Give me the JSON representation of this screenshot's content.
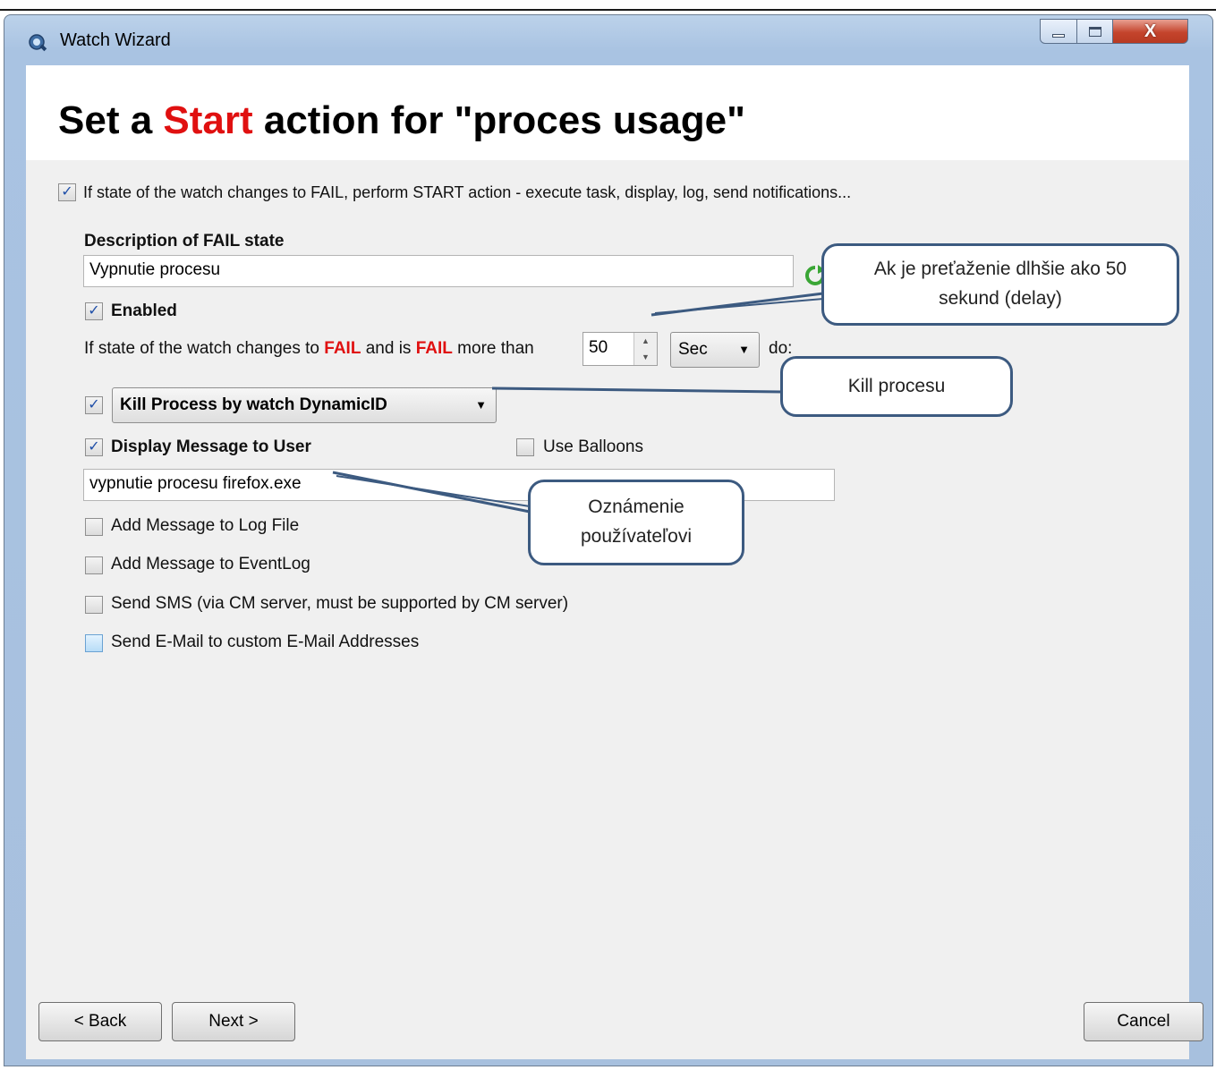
{
  "window": {
    "title": "Watch Wizard",
    "minimize_label": "minimize",
    "maximize_label": "maximize",
    "close_glyph": "X"
  },
  "header": {
    "title_prefix": "Set a ",
    "title_highlight": "Start",
    "title_suffix": " action for \"proces usage\""
  },
  "main": {
    "perform_start_label": "If state of the watch changes to FAIL, perform START action - execute task, display, log, send notifications...",
    "perform_start_checked": true,
    "description_heading": "Description of FAIL state",
    "description_value": "Vypnutie procesu",
    "enabled_label": "Enabled",
    "enabled_checked": true,
    "delay_text_1": "If state of the watch changes to ",
    "delay_fail_1": "FAIL",
    "delay_text_2": " and is ",
    "delay_fail_2": "FAIL",
    "delay_text_3": " more than",
    "delay_value": "50",
    "delay_unit": "Sec",
    "delay_text_4": "do:",
    "action_checked": true,
    "action_selected": "Kill Process by watch DynamicID",
    "display_message_label": "Display Message to User",
    "display_message_checked": true,
    "use_balloons_label": "Use Balloons",
    "use_balloons_checked": false,
    "message_value": "vypnutie procesu firefox.exe",
    "log_file_label": "Add Message to Log File",
    "eventlog_label": "Add Message to EventLog",
    "sms_label": "Send SMS (via CM server, must be supported by CM server)",
    "email_label": "Send E-Mail to custom E-Mail Addresses"
  },
  "callouts": {
    "delay_line1": "Ak je preťaženie dlhšie ako 50",
    "delay_line2": "sekund  (delay)",
    "kill": "Kill procesu",
    "notify_line1": "Oznámenie",
    "notify_line2": "používateľovi",
    "border_color": "#3c5a80"
  },
  "footer": {
    "back_label": "< Back",
    "next_label": "Next >",
    "cancel_label": "Cancel"
  },
  "icons": {
    "app": "magnifier-app-icon",
    "refresh": "refresh-icon",
    "check": "check-mark-icon"
  },
  "colors": {
    "accent_red": "#e01010",
    "client_bg": "#f0f0f0",
    "frame_blue": "#a9c3e2"
  }
}
